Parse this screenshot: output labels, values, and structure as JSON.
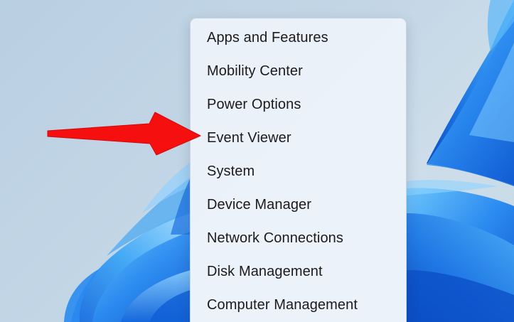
{
  "wallpaper": {
    "name": "windows-11-bloom-wallpaper",
    "colors": {
      "background": "#c3d6e6",
      "petal_light": "#3fa4f2",
      "petal_mid": "#1a73e0",
      "petal_dark": "#0b4fc7"
    }
  },
  "context_menu": {
    "items": [
      {
        "label": "Apps and Features"
      },
      {
        "label": "Mobility Center"
      },
      {
        "label": "Power Options"
      },
      {
        "label": "Event Viewer"
      },
      {
        "label": "System"
      },
      {
        "label": "Device Manager"
      },
      {
        "label": "Network Connections"
      },
      {
        "label": "Disk Management"
      },
      {
        "label": "Computer Management"
      }
    ]
  },
  "annotation": {
    "arrow_color": "#f50f0f",
    "points_to": "Event Viewer"
  }
}
